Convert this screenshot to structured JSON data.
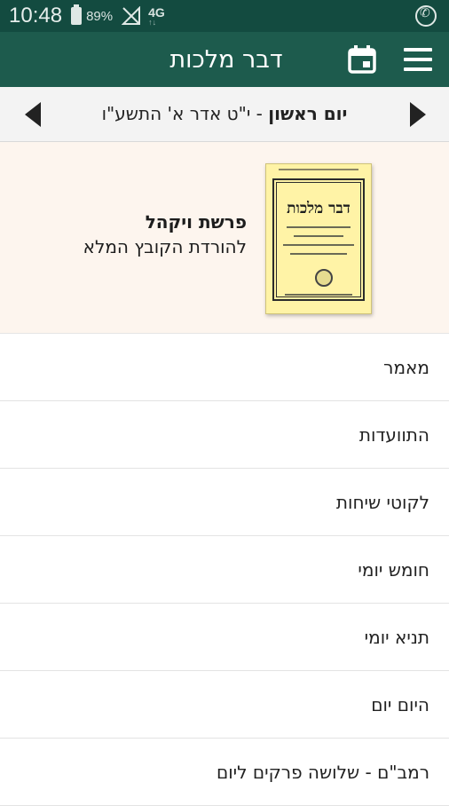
{
  "status_bar": {
    "time": "10:48",
    "battery": "89%",
    "network": "4G",
    "network_sub": "↑↓",
    "whatsapp_icon": "whatsapp-icon"
  },
  "app_bar": {
    "title": "דבר מלכות",
    "color": "#1d5b4d",
    "status_color": "#134b40"
  },
  "date_bar": {
    "day_name": "יום ראשון",
    "date": " - י\"ט אדר א' התשע\"ו"
  },
  "featured": {
    "cover_title": "דבר מלכות",
    "portion": "פרשת ויקהל",
    "download": "להורדת הקובץ המלא"
  },
  "menu": {
    "items": [
      "מאמר",
      "התוועדות",
      "לקוטי שיחות",
      "חומש יומי",
      "תניא יומי",
      "היום יום",
      "רמב\"ם - שלושה פרקים ליום"
    ]
  }
}
